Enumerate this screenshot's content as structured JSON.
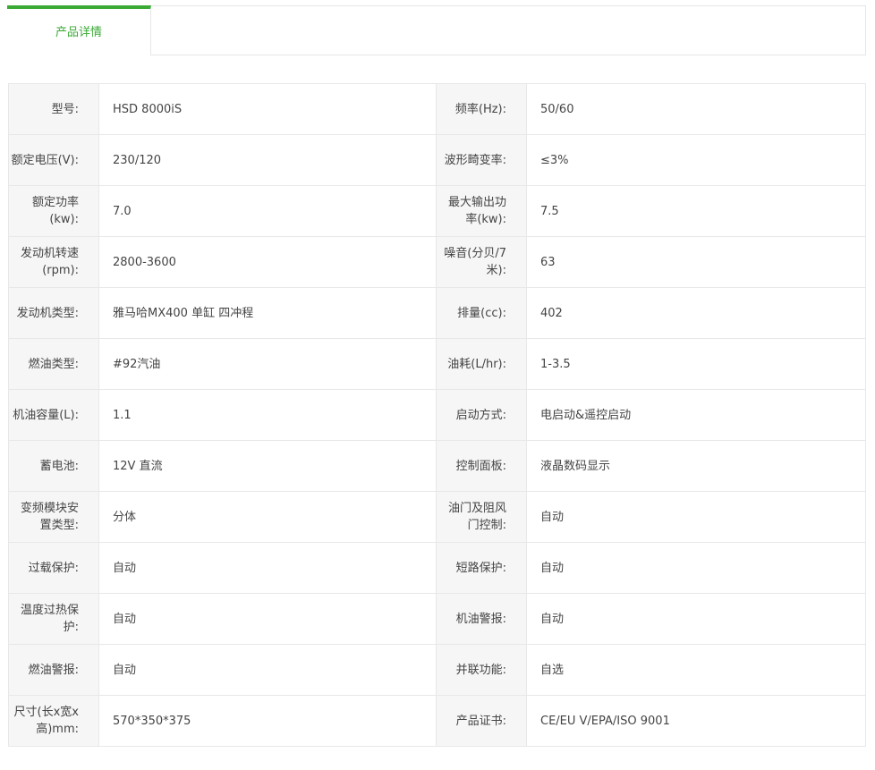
{
  "tabs": [
    {
      "label": "产品详情",
      "active": true
    }
  ],
  "accent_color": "#3aaa35",
  "specs": [
    [
      {
        "label": "型号:",
        "value": "HSD 8000iS"
      },
      {
        "label": "频率(Hz):",
        "value": "50/60"
      }
    ],
    [
      {
        "label": "额定电压(V):",
        "value": "230/120"
      },
      {
        "label": "波形畸变率:",
        "value": "≤3%"
      }
    ],
    [
      {
        "label": "额定功率(kw):",
        "value": "7.0"
      },
      {
        "label": "最大输出功率(kw):",
        "value": "7.5"
      }
    ],
    [
      {
        "label": "发动机转速(rpm):",
        "value": "2800-3600"
      },
      {
        "label": "噪音(分贝/7米):",
        "value": "63"
      }
    ],
    [
      {
        "label": "发动机类型:",
        "value": "雅马哈MX400 单缸 四冲程"
      },
      {
        "label": "排量(cc):",
        "value": "402"
      }
    ],
    [
      {
        "label": "燃油类型:",
        "value": "#92汽油"
      },
      {
        "label": "油耗(L/hr):",
        "value": "1-3.5"
      }
    ],
    [
      {
        "label": "机油容量(L):",
        "value": "1.1"
      },
      {
        "label": "启动方式:",
        "value": "电启动&遥控启动"
      }
    ],
    [
      {
        "label": "蓄电池:",
        "value": "12V 直流"
      },
      {
        "label": "控制面板:",
        "value": "液晶数码显示"
      }
    ],
    [
      {
        "label": "变频模块安置类型:",
        "value": "分体"
      },
      {
        "label": "油门及阻风门控制:",
        "value": "自动"
      }
    ],
    [
      {
        "label": "过载保护:",
        "value": "自动"
      },
      {
        "label": "短路保护:",
        "value": "自动"
      }
    ],
    [
      {
        "label": "温度过热保护:",
        "value": "自动"
      },
      {
        "label": "机油警报:",
        "value": "自动"
      }
    ],
    [
      {
        "label": "燃油警报:",
        "value": "自动"
      },
      {
        "label": "并联功能:",
        "value": "自选"
      }
    ],
    [
      {
        "label": "尺寸(长x宽x高)mm:",
        "value": "570*350*375"
      },
      {
        "label": "产品证书:",
        "value": "CE/EU V/EPA/ISO 9001"
      }
    ]
  ]
}
